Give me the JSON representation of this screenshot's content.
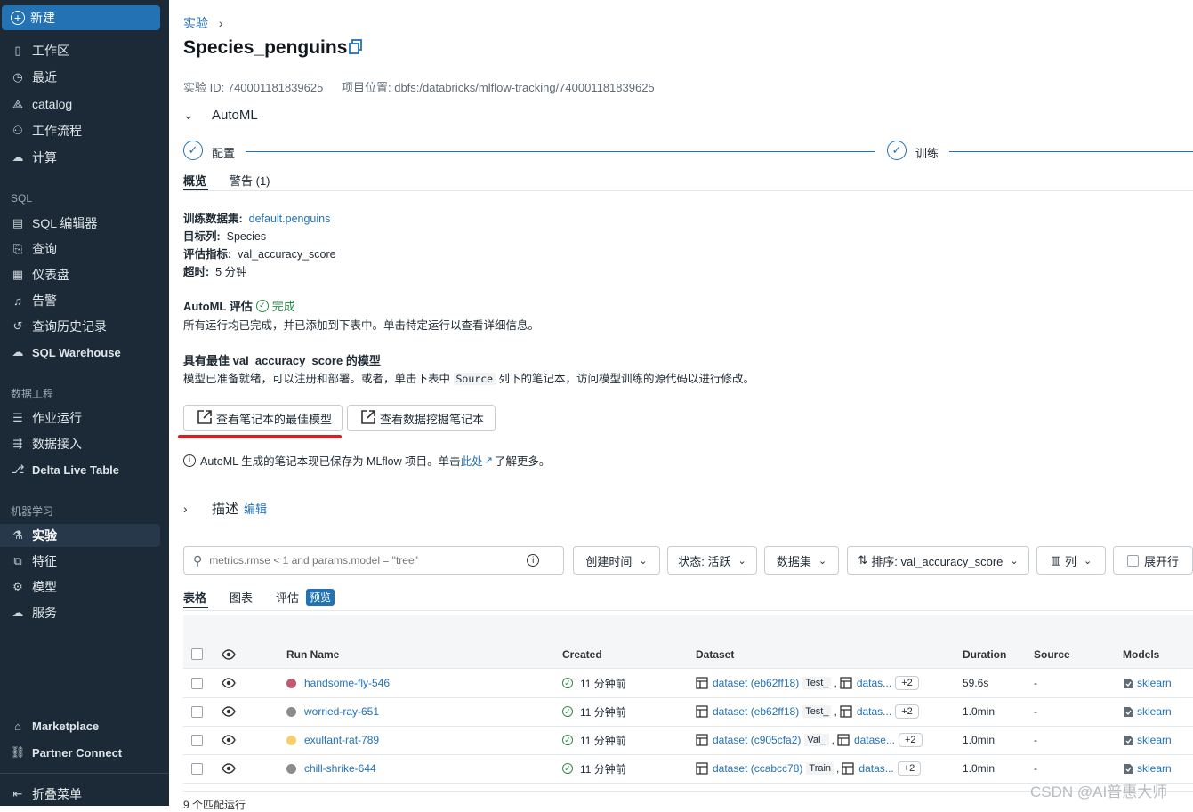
{
  "sidebar": {
    "new_label": "新建",
    "items_top": [
      {
        "label": "工作区",
        "icon": "workspace-icon"
      },
      {
        "label": "最近",
        "icon": "clock-icon"
      },
      {
        "label": "catalog",
        "icon": "catalog-icon"
      },
      {
        "label": "工作流程",
        "icon": "workflow-icon"
      },
      {
        "label": "计算",
        "icon": "cloud-icon"
      }
    ],
    "section_sql": "SQL",
    "items_sql": [
      {
        "label": "SQL 编辑器",
        "icon": "editor-icon"
      },
      {
        "label": "查询",
        "icon": "query-icon"
      },
      {
        "label": "仪表盘",
        "icon": "dashboard-icon"
      },
      {
        "label": "告警",
        "icon": "bell-icon"
      },
      {
        "label": "查询历史记录",
        "icon": "history-icon"
      },
      {
        "label": "SQL Warehouse",
        "icon": "warehouse-icon"
      }
    ],
    "section_data": "数据工程",
    "items_data": [
      {
        "label": "作业运行",
        "icon": "jobs-icon"
      },
      {
        "label": "数据接入",
        "icon": "ingest-icon"
      },
      {
        "label": "Delta Live Table",
        "icon": "delta-icon"
      }
    ],
    "section_ml": "机器学习",
    "items_ml": [
      {
        "label": "实验",
        "icon": "experiment-icon"
      },
      {
        "label": "特征",
        "icon": "feature-icon"
      },
      {
        "label": "模型",
        "icon": "model-icon"
      },
      {
        "label": "服务",
        "icon": "serving-icon"
      }
    ],
    "items_bottom": [
      {
        "label": "Marketplace",
        "icon": "marketplace-icon"
      },
      {
        "label": "Partner Connect",
        "icon": "partner-icon"
      }
    ],
    "collapse_label": "折叠菜单"
  },
  "breadcrumb": "实验",
  "page_title": "Species_penguins",
  "experiment_id": "实验 ID: 740001181839625",
  "project_location": "项目位置: dbfs:/databricks/mlflow-tracking/740001181839625",
  "automl_title": "AutoML",
  "steps": [
    "配置",
    "训练"
  ],
  "tabs_top": [
    "概览",
    "警告 (1)"
  ],
  "overview": {
    "dataset_label": "训练数据集:",
    "dataset_value": "default.penguins",
    "target_label": "目标列:",
    "target_value": "Species",
    "metric_label": "评估指标:",
    "metric_value": "val_accuracy_score",
    "timeout_label": "超时:",
    "timeout_value": "5 分钟"
  },
  "eval": {
    "title": "AutoML 评估",
    "status": "完成",
    "desc": "所有运行均已完成，并已添加到下表中。单击特定运行以查看详细信息。"
  },
  "best": {
    "title": "具有最佳 val_accuracy_score 的模型",
    "desc_before": "模型已准备就绪，可以注册和部署。或者，单击下表中",
    "desc_code": "Source",
    "desc_after": "列下的笔记本，访问模型训练的源代码以进行修改。",
    "btn1": "查看笔记本的最佳模型",
    "btn2": "查看数据挖掘笔记本"
  },
  "info": {
    "before": "AutoML 生成的笔记本现已保存为 MLflow 项目。单击",
    "link": "此处",
    "after": "了解更多。"
  },
  "description": {
    "label": "描述",
    "edit": "编辑"
  },
  "search_placeholder": "metrics.rmse < 1 and params.model = \"tree\"",
  "filters": {
    "created": "创建时间",
    "status": "状态: 活跃",
    "dataset": "数据集",
    "sort": "排序: val_accuracy_score",
    "columns": "列",
    "expand": "展开行"
  },
  "view_tabs": {
    "table": "表格",
    "chart": "图表",
    "eval": "评估",
    "preview": "预览"
  },
  "columns": {
    "run_name": "Run Name",
    "created": "Created",
    "dataset": "Dataset",
    "duration": "Duration",
    "source": "Source",
    "models": "Models"
  },
  "colors": {
    "sidebar_bg": "#1b2a36",
    "accent": "#2272b4",
    "success": "#2c8a47"
  },
  "rows": [
    {
      "name": "handsome-fly-546",
      "color": "#c05a73",
      "created": "11 分钟前",
      "dataset": "dataset (eb62ff18)",
      "tag": "Test_",
      "more": "datas...",
      "plus": "+2",
      "duration": "59.6s",
      "source": "-",
      "model": "sklearn"
    },
    {
      "name": "worried-ray-651",
      "color": "#8c8c8c",
      "created": "11 分钟前",
      "dataset": "dataset (eb62ff18)",
      "tag": "Test_",
      "more": "datas...",
      "plus": "+2",
      "duration": "1.0min",
      "source": "-",
      "model": "sklearn"
    },
    {
      "name": "exultant-rat-789",
      "color": "#f5cf6b",
      "created": "11 分钟前",
      "dataset": "dataset (c905cfa2)",
      "tag": "Val_",
      "more": "datase...",
      "plus": "+2",
      "duration": "1.0min",
      "source": "-",
      "model": "sklearn"
    },
    {
      "name": "chill-shrike-644",
      "color": "#8c8c8c",
      "created": "11 分钟前",
      "dataset": "dataset (ccabcc78)",
      "tag": "Train",
      "more": "datas...",
      "plus": "+2",
      "duration": "1.0min",
      "source": "-",
      "model": "sklearn"
    }
  ],
  "footer_count": "9 个匹配运行",
  "watermark": "CSDN @AI普惠大师"
}
